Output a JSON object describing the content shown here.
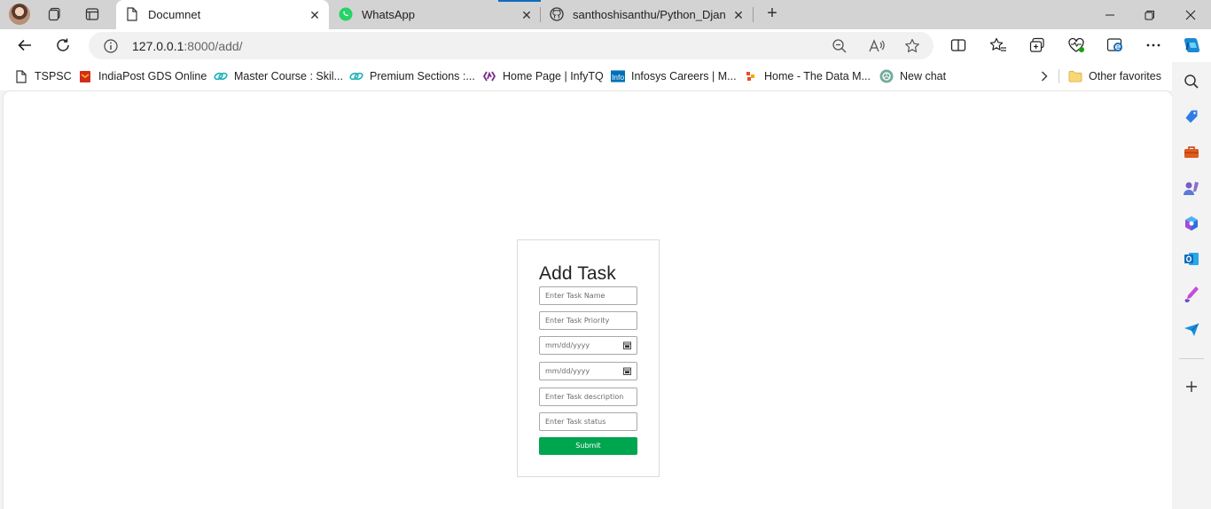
{
  "tabs": [
    {
      "title": "Documnet",
      "icon": "page-icon",
      "active": true
    },
    {
      "title": "WhatsApp",
      "icon": "whatsapp-icon",
      "active": false
    },
    {
      "title": "santhoshisanthu/Python_Django",
      "icon": "github-icon",
      "active": false
    }
  ],
  "address_bar": {
    "host": "127.0.0.1",
    "path": ":8000/add/"
  },
  "favorites": [
    {
      "label": "TSPSC",
      "icon": "page-icon"
    },
    {
      "label": "IndiaPost GDS Online",
      "icon": "indiapost-icon"
    },
    {
      "label": "Master Course : Skil...",
      "icon": "skill-icon"
    },
    {
      "label": "Premium Sections :...",
      "icon": "skill-icon"
    },
    {
      "label": "Home Page | InfyTQ",
      "icon": "infytq-icon"
    },
    {
      "label": "Infosys Careers | M...",
      "icon": "infosys-icon"
    },
    {
      "label": "Home - The Data M...",
      "icon": "datam-icon"
    },
    {
      "label": "New chat",
      "icon": "chatgpt-icon"
    }
  ],
  "favorites_other": {
    "label": "Other favorites",
    "icon": "folder-icon"
  },
  "form": {
    "title": "Add Task",
    "task_name_placeholder": "Enter Task Name",
    "task_priority_placeholder": "Enter Task Priority",
    "start_date_placeholder": "mm/dd/yyyy",
    "end_date_placeholder": "mm/dd/yyyy",
    "task_description_placeholder": "Enter Task description",
    "task_status_placeholder": "Enter Task status",
    "submit_label": "Submit"
  },
  "colors": {
    "submit_button": "#00a64f",
    "tab_strip": "#d3d3d3",
    "accent": "#0f6cbd"
  }
}
